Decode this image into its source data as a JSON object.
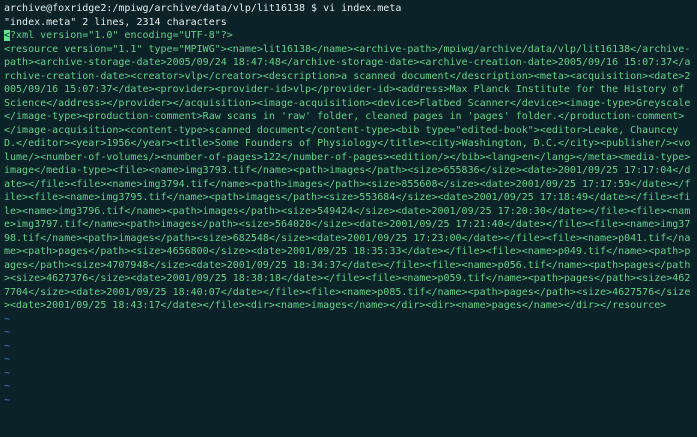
{
  "terminal": {
    "prompt_line": "archive@foxridge2:/mpiwg/archive/data/vlp/lit16138 $ vi index.meta",
    "status_line": "\"index.meta\" 2 lines, 2314 characters",
    "cursor_char": "<",
    "first_line_rest": "?xml version=\"1.0\" encoding=\"UTF-8\"?>",
    "content_line": "<resource version=\"1.1\" type=\"MPIWG\"><name>lit16138</name><archive-path>/mpiwg/archive/data/vlp/lit16138</archive-path><archive-storage-date>2005/09/24 18:47:48</archive-storage-date><archive-creation-date>2005/09/16 15:07:37</archive-creation-date><creator>vlp</creator><description>a scanned document</description><meta><acquisition><date>2005/09/16 15:07:37</date><provider><provider-id>vlp</provider-id><address>Max Planck Institute for the History of Science</address></provider></acquisition><image-acquisition><device>Flatbed Scanner</device><image-type>Greyscale</image-type><production-comment>Raw scans in 'raw' folder, cleaned pages in 'pages' folder.</production-comment></image-acquisition><content-type>scanned document</content-type><bib type=\"edited-book\"><editor>Leake, Chauncey D.</editor><year>1956</year><title>Some Founders of Physiology</title><city>Washington, D.C.</city><publisher/><volume/><number-of-volumes/><number-of-pages>122</number-of-pages><edition/></bib><lang>en</lang></meta><media-type>image</media-type><file><name>img3793.tif</name><path>images</path><size>655836</size><date>2001/09/25 17:17:04</date></file><file><name>img3794.tif</name><path>images</path><size>855608</size><date>2001/09/25 17:17:59</date></file><file><name>img3795.tif</name><path>images</path><size>553684</size><date>2001/09/25 17:18:49</date></file><file><name>img3796.tif</name><path>images</path><size>549424</size><date>2001/09/25 17:20:30</date></file><file><name>img3797.tif</name><path>images</path><size>564020</size><date>2001/09/25 17:21:40</date></file><file><name>img3798.tif</name><path>images</path><size>682548</size><date>2001/09/25 17:23:00</date></file><file><name>p041.tif</name><path>pages</path><size>4656800</size><date>2001/09/25 18:35:33</date></file><file><name>p049.tif</name><path>pages</path><size>4707948</size><date>2001/09/25 18:34:37</date></file><file><name>p056.tif</name><path>pages</path><size>4627376</size><date>2001/09/25 18:38:18</date></file><file><name>p059.tif</name><path>pages</path><size>4627704</size><date>2001/09/25 18:40:07</date></file><file><name>p085.tif</name><path>pages</path><size>4627576</size><date>2001/09/25 18:43:17</date></file><dir><name>images</name></dir><dir><name>pages</name></dir></resource>",
    "tilde_char": "~"
  }
}
